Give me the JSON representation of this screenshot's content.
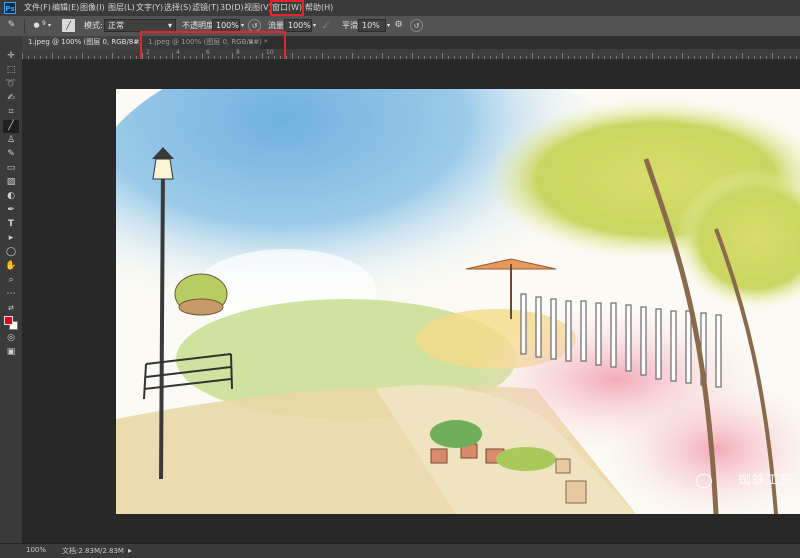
{
  "app": {
    "logo": "Ps"
  },
  "menu": {
    "items": [
      "文件(F)",
      "编辑(E)",
      "图像(I)",
      "图层(L)",
      "文字(Y)",
      "选择(S)",
      "滤镜(T)",
      "3D(D)",
      "视图(V)",
      "窗口(W)",
      "帮助(H)"
    ],
    "highlighted": "窗口(W)"
  },
  "options": {
    "brush_size": "9",
    "mode_label": "模式:",
    "mode_value": "正常",
    "opacity_label": "不透明度:",
    "opacity_value": "100%",
    "flow_label": "流量:",
    "flow_value": "100%",
    "smooth_label": "平滑:",
    "smooth_value": "10%"
  },
  "tabs": [
    {
      "label": "1.jpeg @ 100% (图层 0, RGB/8#) *",
      "close": "×"
    },
    {
      "label": "1.jpeg @ 100% (图层 0, RGB/8#) *",
      "close": "×"
    }
  ],
  "ruler": {
    "labels": [
      "2",
      "4",
      "6",
      "8",
      "10"
    ]
  },
  "tools": [
    "move-icon",
    "marquee-icon",
    "lasso-icon",
    "quick-select-icon",
    "crop-icon",
    "eyedropper-icon",
    "healing-icon",
    "brush-icon",
    "stamp-icon",
    "history-brush-icon",
    "eraser-icon",
    "gradient-icon",
    "dodge-icon",
    "pen-icon",
    "type-icon",
    "path-select-icon",
    "shape-icon",
    "hand-icon",
    "zoom-icon",
    "more-icon"
  ],
  "colors": {
    "foreground": "#e2001a",
    "background": "#ffffff",
    "highlight": "#e2262e"
  },
  "watermark": {
    "text": "蜘蛛工房"
  },
  "status": {
    "zoom": "100%",
    "doc": "文档:2.83M/2.83M"
  }
}
